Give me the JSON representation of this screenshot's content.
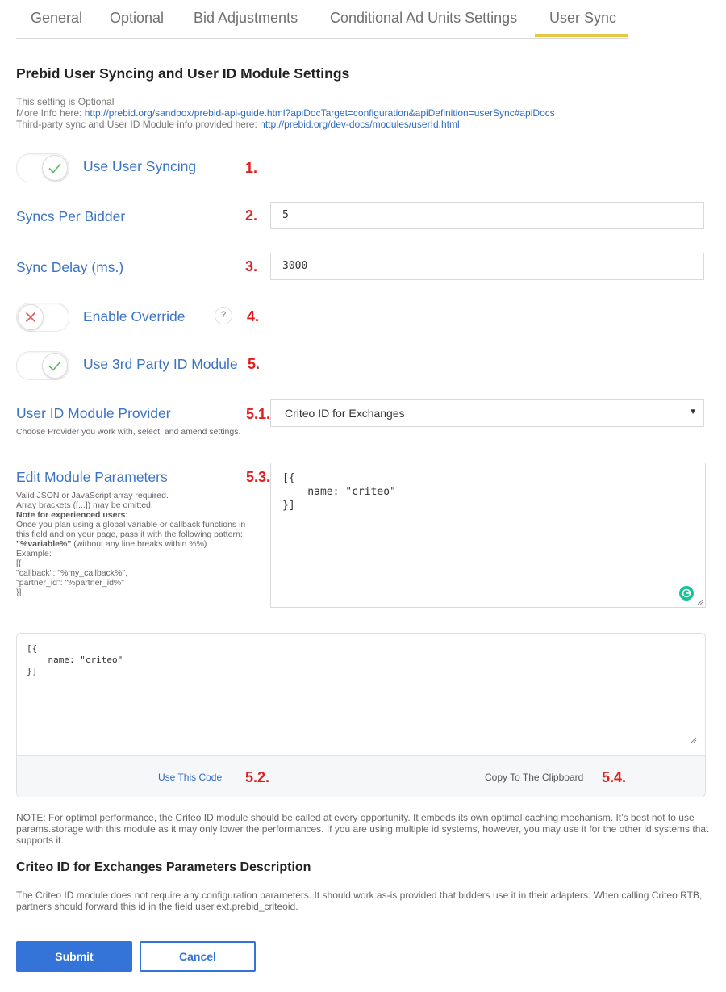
{
  "tabs": [
    {
      "label": "General",
      "active": false
    },
    {
      "label": "Optional",
      "active": false
    },
    {
      "label": "Bid Adjustments",
      "active": false
    },
    {
      "label": "Conditional Ad Units Settings",
      "active": false
    },
    {
      "label": "User Sync",
      "active": true
    }
  ],
  "colors": {
    "accent": "#3474d9",
    "label_blue": "#3b74c4",
    "step_red": "#e02020",
    "tab_underline": "#e9c546",
    "toggle_on": "#5cb85c",
    "toggle_off": "#e05555"
  },
  "header": {
    "title": "Prebid User Syncing and User ID Module Settings",
    "optional_note": "This setting is Optional",
    "more_info_prefix": "More Info here:",
    "more_info_link": "http://prebid.org/sandbox/prebid-api-guide.html?apiDocTarget=configuration&apiDefinition=userSync#apiDocs",
    "third_party_prefix": "Third-party sync and User ID Module info provided here:",
    "third_party_link": "http://prebid.org/dev-docs/modules/userId.html"
  },
  "fields": {
    "use_user_syncing": {
      "label": "Use User Syncing",
      "step": "1.",
      "enabled": true,
      "icon": "check-icon"
    },
    "syncs_per_bidder": {
      "label": "Syncs Per Bidder",
      "step": "2.",
      "value": "5"
    },
    "sync_delay": {
      "label": "Sync Delay (ms.)",
      "step": "3.",
      "value": "3000"
    },
    "enable_override": {
      "label": "Enable Override",
      "step": "4.",
      "enabled": false,
      "icon": "x-icon",
      "help": "?"
    },
    "use_3rd_party_id": {
      "label": "Use 3rd Party ID Module",
      "step": "5.",
      "enabled": true,
      "icon": "check-icon"
    },
    "provider": {
      "label": "User ID Module Provider",
      "step": "5.1.",
      "help": "Choose Provider you work with, select, and amend settings.",
      "selected": "Criteo ID for Exchanges",
      "caret": "▼"
    },
    "module_params": {
      "label": "Edit Module Parameters",
      "step": "5.3.",
      "value": "[{\n    name: \"criteo\"\n}]",
      "help_lines": [
        "Valid JSON or JavaScript array required.",
        "Array brackets ([...]) may be omitted.",
        "Note for experienced users:",
        "Once you plan using a global variable or callback functions in",
        "this field and on your page, pass it with the following pattern:",
        "\"%variable%\"",
        " (without any line breaks within %%)",
        "Example:",
        "[{",
        "\"callback\": \"%my_callback%\",",
        "\"partner_id\": \"%partner_id%\"",
        "}]"
      ]
    }
  },
  "code_panel": {
    "code": "[{\n    name: \"criteo\"\n}]",
    "use_code_label": "Use This Code",
    "use_code_step": "5.2.",
    "copy_label": "Copy To The Clipboard",
    "copy_step": "5.4."
  },
  "note": "NOTE: For optimal performance, the Criteo ID module should be called at every opportunity. It embeds its own optimal caching mechanism. It’s best not to use params.storage with this module as it may only lower the performances. If you are using multiple id systems, however, you may use it for the other id systems that supports it.",
  "description": {
    "title": "Criteo ID for Exchanges Parameters Description",
    "text": "The Criteo ID module does not require any configuration parameters. It should work as-is provided that bidders use it in their adapters. When calling Criteo RTB, partners should forward this id in the field user.ext.prebid_criteoid."
  },
  "actions": {
    "submit": "Submit",
    "cancel": "Cancel"
  }
}
